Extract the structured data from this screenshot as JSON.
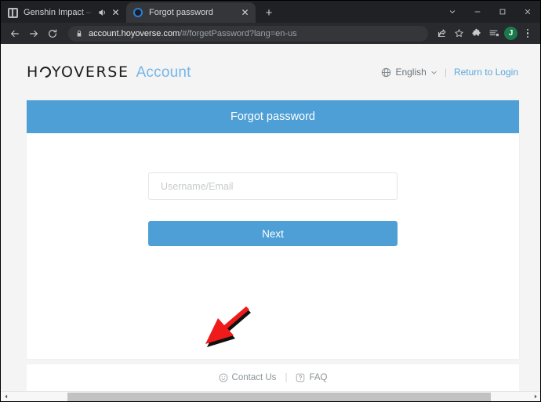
{
  "browser": {
    "tabs": [
      {
        "title": "Genshin Impact – Step Into a",
        "favicon": "genshin-favicon",
        "active": false,
        "audio_icon": "speaker-icon",
        "close_label": "✕"
      },
      {
        "title": "Forgot password",
        "favicon": "hoyoverse-favicon",
        "active": true,
        "close_label": "✕"
      }
    ],
    "new_tab_label": "+",
    "window_controls": {
      "tab_search": "tab-search-chevron",
      "minimize": "minimize",
      "maximize": "maximize",
      "close": "close"
    },
    "toolbar": {
      "back": "back-arrow",
      "forward": "forward-arrow",
      "reload": "reload-arrow",
      "lock": "lock-icon",
      "url_host": "account.hoyoverse.com",
      "url_path": "/#/forgetPassword?lang=en-us",
      "url_full": "account.hoyoverse.com/#/forgetPassword?lang=en-us",
      "share": "share-icon",
      "bookmark": "star-icon",
      "extensions": "puzzle-icon",
      "collections": "collections-icon",
      "profile_initial": "J",
      "menu": "three-dot-menu"
    }
  },
  "page": {
    "logo": {
      "brand_part1": "H",
      "brand_part2": "YOVERSE",
      "product": "Account"
    },
    "header": {
      "language": "English",
      "separator": "|",
      "return_to_login": "Return to Login"
    },
    "card": {
      "title": "Forgot password",
      "username_placeholder": "Username/Email",
      "username_value": "",
      "next_label": "Next"
    },
    "footer": {
      "contact_us": "Contact Us",
      "separator": "|",
      "faq": "FAQ"
    }
  },
  "colors": {
    "accent_blue": "#4d9fd5",
    "link_blue": "#5ba8de",
    "logo_blue": "#74b6e8",
    "annotation_red": "#ef1b1b",
    "chrome_dark": "#202124",
    "toolbar_dark": "#292a2d",
    "active_tab": "#35363a",
    "avatar_green": "#1a7a4c",
    "page_bg": "#f4f4f4"
  },
  "annotation": {
    "type": "arrow",
    "points_to": "next-button",
    "color": "#ef1b1b"
  }
}
